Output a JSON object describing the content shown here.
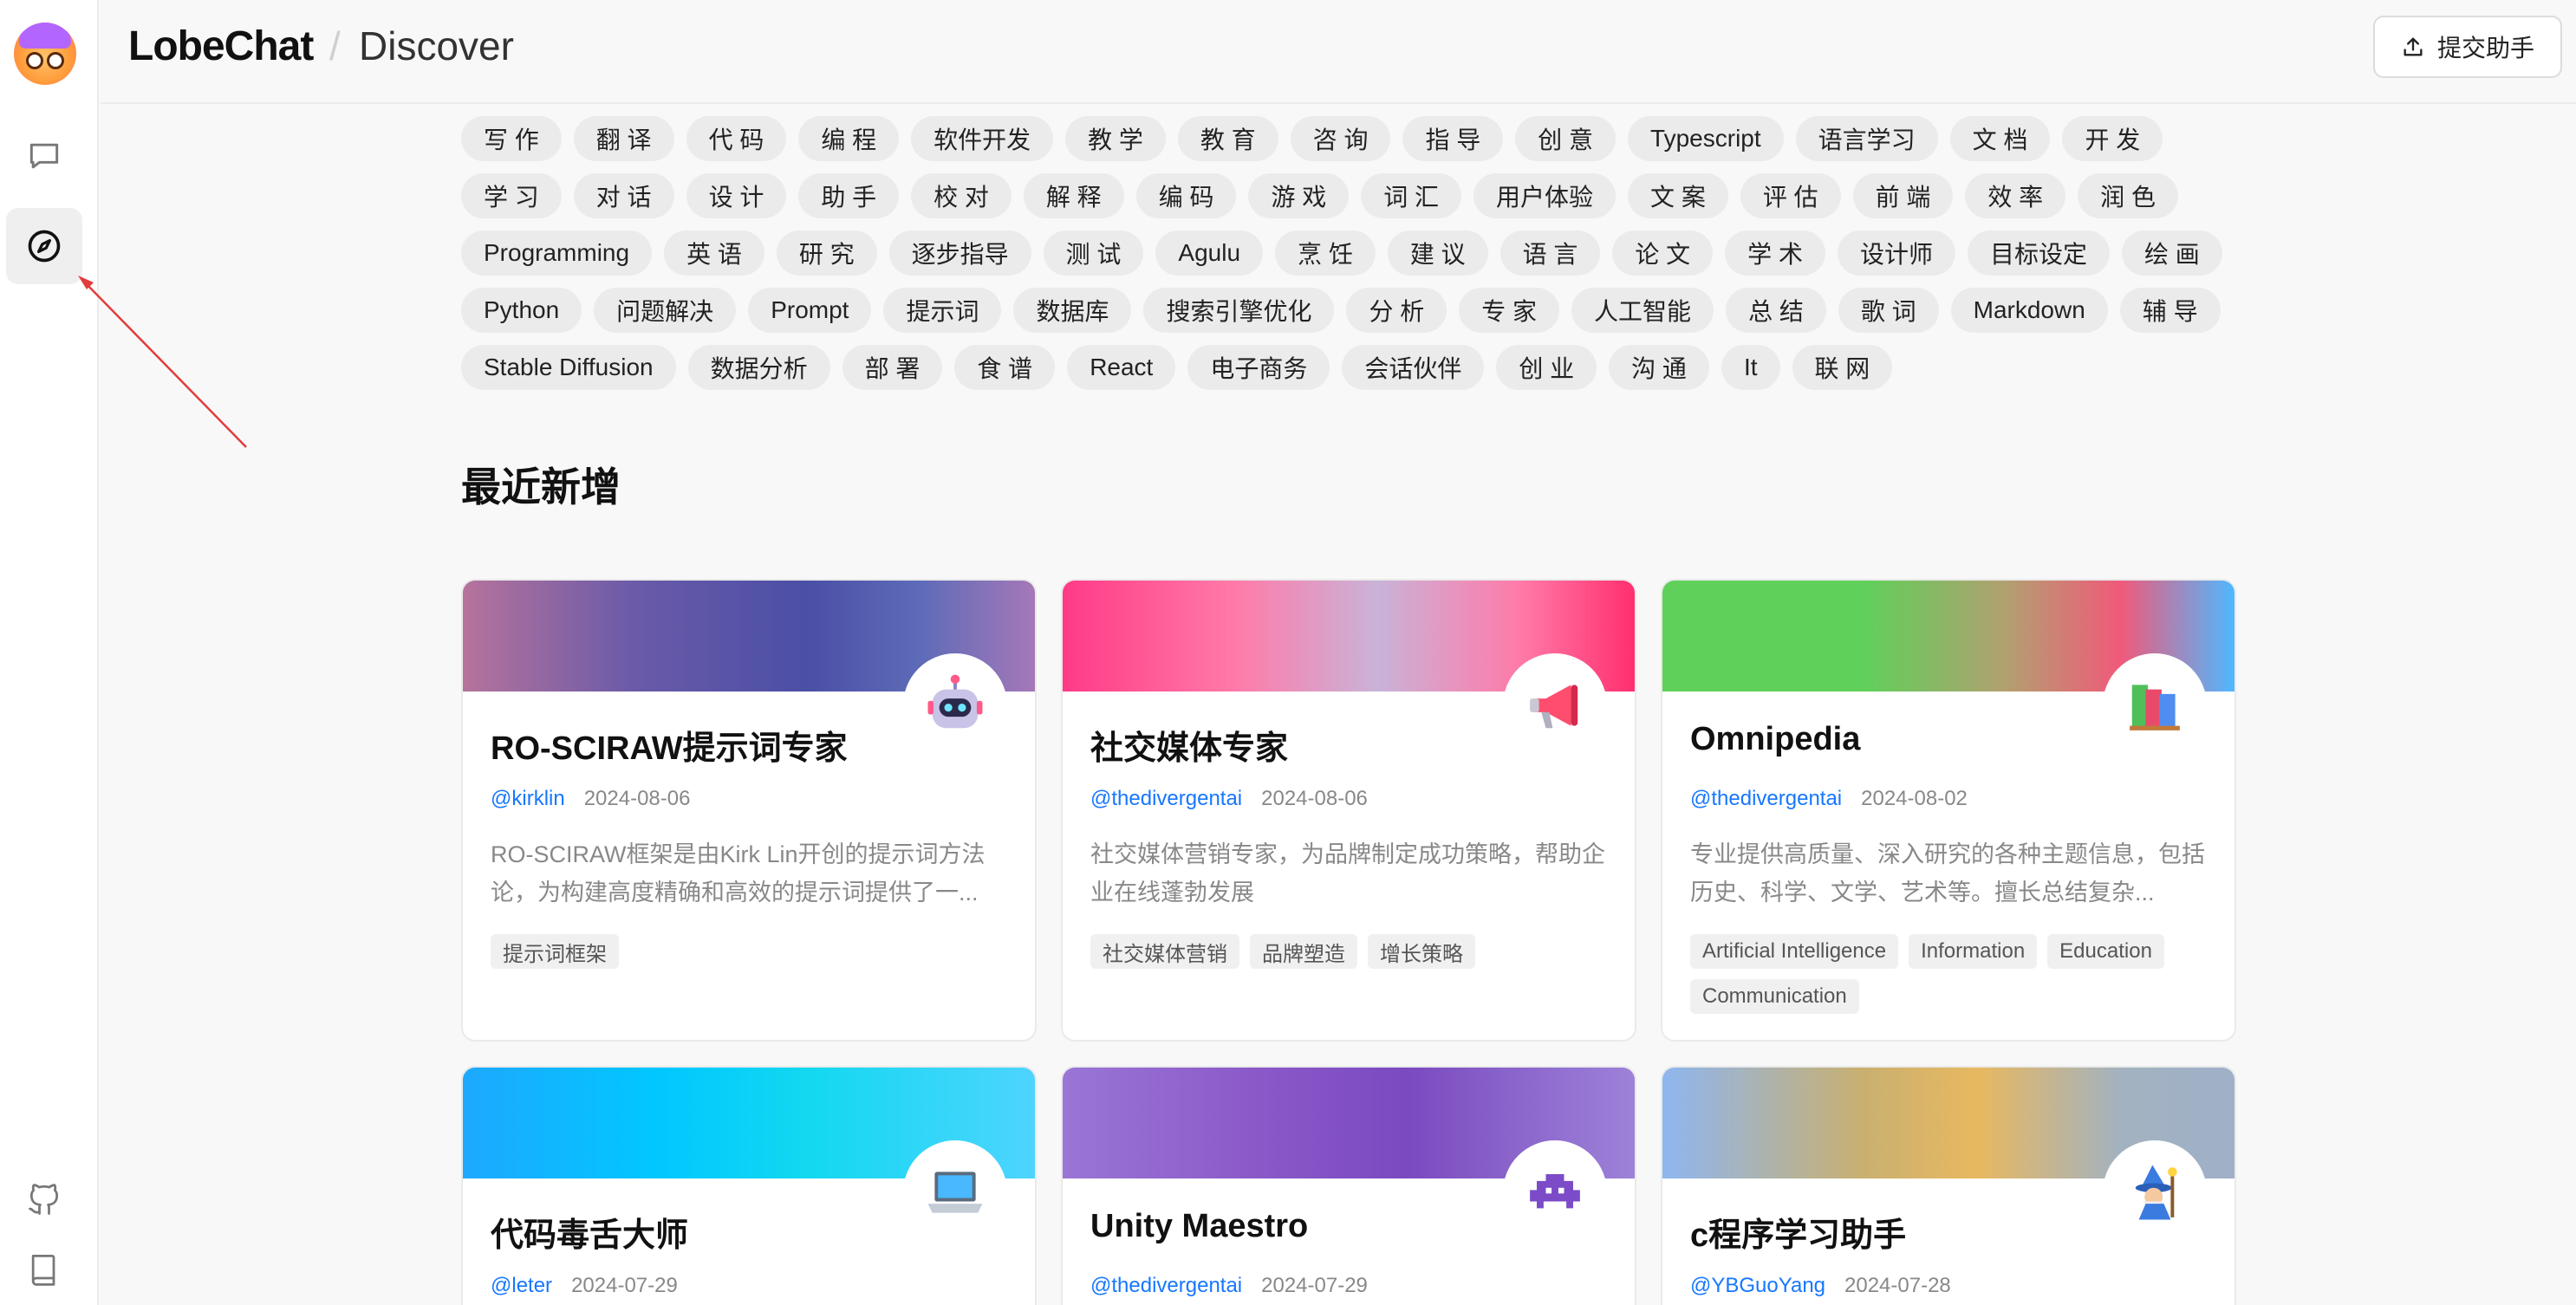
{
  "header": {
    "logo": "LobeChat",
    "separator": "/",
    "section": "Discover",
    "submit_label": "提交助手"
  },
  "tags": [
    [
      "写 作",
      "翻 译",
      "代 码",
      "编 程",
      "软件开发",
      "教 学",
      "教 育",
      "咨 询",
      "指 导",
      "创 意",
      "Typescript",
      "语言学习",
      "文 档",
      "开 发"
    ],
    [
      "学 习",
      "对 话",
      "设 计",
      "助 手",
      "校 对",
      "解 释",
      "编 码",
      "游 戏",
      "词 汇",
      "用户体验",
      "文 案",
      "评 估",
      "前 端",
      "效 率",
      "润 色"
    ],
    [
      "Programming",
      "英 语",
      "研 究",
      "逐步指导",
      "测 试",
      "Agulu",
      "烹 饪",
      "建 议",
      "语 言",
      "论 文",
      "学 术",
      "设计师",
      "目标设定",
      "绘 画"
    ],
    [
      "Python",
      "问题解决",
      "Prompt",
      "提示词",
      "数据库",
      "搜索引擎优化",
      "分 析",
      "专 家",
      "人工智能",
      "总 结",
      "歌 词",
      "Markdown",
      "辅 导"
    ],
    [
      "Stable Diffusion",
      "数据分析",
      "部 署",
      "食 谱",
      "React",
      "电子商务",
      "会话伙伴",
      "创 业",
      "沟 通",
      "It",
      "联 网"
    ]
  ],
  "recent_title": "最近新增",
  "cards": [
    {
      "title": "RO-SCIRAW提示词专家",
      "author": "@kirklin",
      "date": "2024-08-06",
      "desc": "RO-SCIRAW框架是由Kirk Lin开创的提示词方法论，为构建高度精确和高效的提示词提供了一...",
      "tags": [
        "提示词框架"
      ],
      "icon": "robot-icon",
      "banner": "linear-gradient(90deg, #b6739c 0%, #6a5aa8 30%, #4b4fa6 60%, #5e6bb8 80%, #a578b8 100%)"
    },
    {
      "title": "社交媒体专家",
      "author": "@thedivergentai",
      "date": "2024-08-06",
      "desc": "社交媒体营销专家，为品牌制定成功策略，帮助企业在线蓬勃发展",
      "tags": [
        "社交媒体营销",
        "品牌塑造",
        "增长策略"
      ],
      "icon": "megaphone-icon",
      "banner": "linear-gradient(90deg, #ff3a86 0%, #ff7aa8 30%, #c9b3d8 55%, #ff7aa8 80%, #ff2f6f 100%)"
    },
    {
      "title": "Omnipedia",
      "author": "@thedivergentai",
      "date": "2024-08-02",
      "desc": "专业提供高质量、深入研究的各种主题信息，包括历史、科学、文学、艺术等。擅长总结复杂...",
      "tags": [
        "Artificial Intelligence",
        "Information",
        "Education",
        "Communication"
      ],
      "icon": "books-icon",
      "banner": "linear-gradient(90deg, #5fd05a 0%, #5fd05a 35%, #b2a070 60%, #f05a7a 80%, #4fb8ff 100%)"
    },
    {
      "title": "代码毒舌大师",
      "author": "@leter",
      "date": "2024-07-29",
      "desc": "",
      "tags": [],
      "icon": "laptop-icon",
      "banner": "linear-gradient(90deg, #1ea8ff 0%, #00c8ff 35%, #12d8f0 60%, #4ed4ff 100%)"
    },
    {
      "title": "Unity Maestro",
      "author": "@thedivergentai",
      "date": "2024-07-29",
      "desc": "",
      "tags": [],
      "icon": "alien-monster-icon",
      "banner": "linear-gradient(90deg, #9a76d6 0%, #8a58c8 35%, #7a4ac0 60%, #9d82d8 100%)"
    },
    {
      "title": "c程序学习助手",
      "author": "@YBGuoYang",
      "date": "2024-07-28",
      "desc": "",
      "tags": [],
      "icon": "wizard-icon",
      "banner": "linear-gradient(90deg, #8eb6f0 0%, #c9b070 35%, #e8b860 55%, #a3b2c0 80%, #9fb0c8 100%)"
    }
  ]
}
